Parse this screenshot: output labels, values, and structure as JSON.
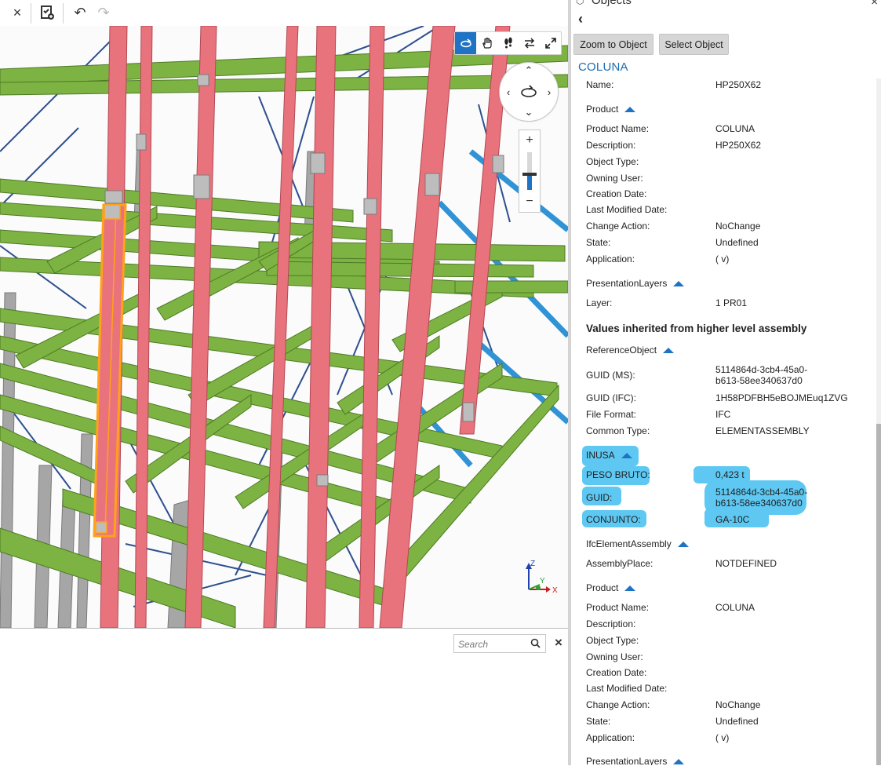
{
  "toolbar": {
    "close_icon": "×",
    "checklist_icon": "clipboard-check",
    "undo_icon": "↶",
    "redo_icon": "↷"
  },
  "viewport": {
    "nav_tools": [
      "orbit-icon",
      "pan-hand-icon",
      "walk-icon",
      "swap-icon",
      "fit-view-icon"
    ],
    "active_tool": "orbit",
    "zoom_level_fraction": 0.42,
    "axis_labels": {
      "x": "X",
      "y": "Y",
      "z": "Z"
    },
    "colors": {
      "columns": "#e8737c",
      "beams": "#7db343",
      "braces": "#2d4f8e",
      "diag_braces": "#2f93d6",
      "secondary": "#a6a6a6",
      "selection": "#ffa21a"
    }
  },
  "bottom_panel": {
    "search_placeholder": "Search",
    "close_icon": "×"
  },
  "panel": {
    "title": "Objects",
    "zoom_button": "Zoom to Object",
    "select_button": "Select Object",
    "object_title": "COLUNA",
    "accent": "#1a6cb0",
    "highlight_color": "#5ec8f2"
  },
  "props": {
    "name_label": "Name:",
    "name_value": "HP250X62",
    "product_head": "Product",
    "product_name_label": "Product Name:",
    "product_name_value": "COLUNA",
    "description_label": "Description:",
    "description_value": "HP250X62",
    "object_type_label": "Object Type:",
    "owning_user_label": "Owning User:",
    "creation_date_label": "Creation Date:",
    "last_modified_label": "Last Modified Date:",
    "change_action_label": "Change Action:",
    "change_action_value": "NoChange",
    "state_label": "State:",
    "state_value": "Undefined",
    "application_label": "Application:",
    "application_value": "( v)",
    "presentation_layers_head": "PresentationLayers",
    "layer_label": "Layer:",
    "layer_value": "1 PR01",
    "inherited_head": "Values inherited from higher level assembly",
    "reference_object_head": "ReferenceObject",
    "guid_ms_label": "GUID (MS):",
    "guid_ms_value": "5114864d-3cb4-45a0-\nb613-58ee340637d0",
    "guid_ifc_label": "GUID (IFC):",
    "guid_ifc_value": "1H58PDFBH5eBOJMEuq1ZVG",
    "file_format_label": "File Format:",
    "file_format_value": "IFC",
    "common_type_label": "Common Type:",
    "common_type_value": "ELEMENTASSEMBLY",
    "inusa_head": "INUSA",
    "peso_label": "PESO BRUTO:",
    "peso_value": "0,423 t",
    "guid_label": "GUID:",
    "guid_value": "5114864d-3cb4-45a0-\nb613-58ee340637d0",
    "conjunto_label": "CONJUNTO:",
    "conjunto_value": "GA-10C",
    "ifc_assembly_head": "IfcElementAssembly",
    "assembly_place_label": "AssemblyPlace:",
    "assembly_place_value": "NOTDEFINED",
    "product2_head": "Product",
    "product_name2_label": "Product Name:",
    "product_name2_value": "COLUNA",
    "description2_label": "Description:",
    "object_type2_label": "Object Type:",
    "owning_user2_label": "Owning User:",
    "creation_date2_label": "Creation Date:",
    "last_modified2_label": "Last Modified Date:",
    "change_action2_label": "Change Action:",
    "change_action2_value": "NoChange",
    "state2_label": "State:",
    "state2_value": "Undefined",
    "application2_label": "Application:",
    "application2_value": "( v)",
    "presentation_layers2_head": "PresentationLayers"
  }
}
